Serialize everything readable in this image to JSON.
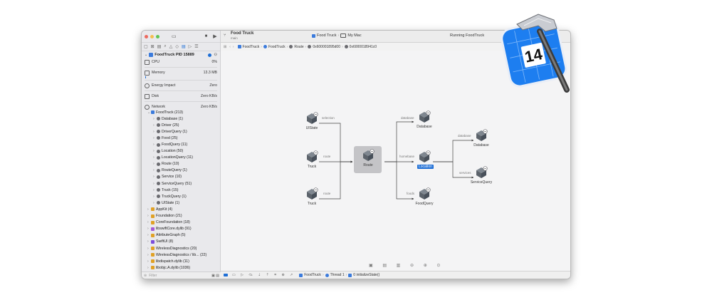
{
  "toolbar": {
    "project_name": "Food Truck",
    "branch": "main",
    "scheme": "Food Truck",
    "destination": "My Mac",
    "status": "Running FoodTruck"
  },
  "jumpbar": [
    "FoodTruck",
    "FoodTruck",
    "Route",
    "0x600001895d00",
    "0x6000018941c0"
  ],
  "debug_navigator": {
    "process": "FoodTruck PID 15889",
    "gauges": [
      {
        "label": "CPU",
        "value": "0%"
      },
      {
        "label": "Memory",
        "value": "13.3 MB"
      },
      {
        "label": "Energy Impact",
        "value": "Zero"
      },
      {
        "label": "Disk",
        "value": "Zero KB/s"
      },
      {
        "label": "Network",
        "value": "Zero KB/s"
      }
    ]
  },
  "tree": [
    {
      "label": "FoodTruck (213)",
      "level": 1,
      "expanded": true,
      "color": "#3b7bdc"
    },
    {
      "label": "Database (1)",
      "level": 2,
      "color": "#6b6b70"
    },
    {
      "label": "Driver (25)",
      "level": 2,
      "color": "#6b6b70"
    },
    {
      "label": "DriverQuery (1)",
      "level": 2,
      "color": "#6b6b70"
    },
    {
      "label": "Food (25)",
      "level": 2,
      "color": "#6b6b70"
    },
    {
      "label": "FoodQuery (11)",
      "level": 2,
      "color": "#6b6b70"
    },
    {
      "label": "Location (50)",
      "level": 2,
      "color": "#6b6b70"
    },
    {
      "label": "LocationQuery (11)",
      "level": 2,
      "color": "#6b6b70"
    },
    {
      "label": "Route (10)",
      "level": 2,
      "color": "#6b6b70"
    },
    {
      "label": "RouteQuery (1)",
      "level": 2,
      "color": "#6b6b70"
    },
    {
      "label": "Service (10)",
      "level": 2,
      "color": "#6b6b70"
    },
    {
      "label": "ServiceQuery (51)",
      "level": 2,
      "color": "#6b6b70"
    },
    {
      "label": "Truck (15)",
      "level": 2,
      "color": "#6b6b70"
    },
    {
      "label": "TruckQuery (1)",
      "level": 2,
      "color": "#6b6b70"
    },
    {
      "label": "UIState (1)",
      "level": 2,
      "color": "#6b6b70"
    },
    {
      "label": "AppKit (4)",
      "level": 1,
      "color": "#e0a126"
    },
    {
      "label": "Foundation (21)",
      "level": 1,
      "color": "#e0a126"
    },
    {
      "label": "CoreFoundation (18)",
      "level": 1,
      "color": "#e0a126"
    },
    {
      "label": "libswiftCore.dylib (91)",
      "level": 1,
      "color": "#a45ad6"
    },
    {
      "label": "AttributeGraph (5)",
      "level": 1,
      "color": "#e0a126"
    },
    {
      "label": "SwiftUI (8)",
      "level": 1,
      "color": "#7c4ddc"
    },
    {
      "label": "WirelessDiagnostics (20)",
      "level": 1,
      "color": "#e0a126"
    },
    {
      "label": "WirelessDiagnostics / lib... (22)",
      "level": 1,
      "color": "#e0a126"
    },
    {
      "label": "libdispatch.dylib (11)",
      "level": 1,
      "color": "#e0a126"
    },
    {
      "label": "libobjc.A.dylib (1036)",
      "level": 1,
      "color": "#e0a126"
    }
  ],
  "filter_placeholder": "Filter",
  "graph": {
    "nodes": [
      {
        "id": "uistate",
        "label": "UIState"
      },
      {
        "id": "truck1",
        "label": "Truck"
      },
      {
        "id": "truck2",
        "label": "Truck"
      },
      {
        "id": "route",
        "label": "Route"
      },
      {
        "id": "database1",
        "label": "Database"
      },
      {
        "id": "location",
        "label": "Location"
      },
      {
        "id": "foodquery",
        "label": "FoodQuery"
      },
      {
        "id": "database2",
        "label": "Database"
      },
      {
        "id": "servicequery",
        "label": "ServiceQuery"
      }
    ],
    "edge_labels": [
      "selection",
      "route",
      "route",
      "database",
      "homebase",
      "foods",
      "database",
      "services"
    ]
  },
  "bottombar": {
    "breadcrumb": [
      "FoodTruck",
      "Thread 1",
      "0 initializeState()"
    ]
  },
  "badge": {
    "version": "14"
  },
  "colors": {
    "accent": "#1f6fd6",
    "selection_box": "#bfbfc2"
  }
}
